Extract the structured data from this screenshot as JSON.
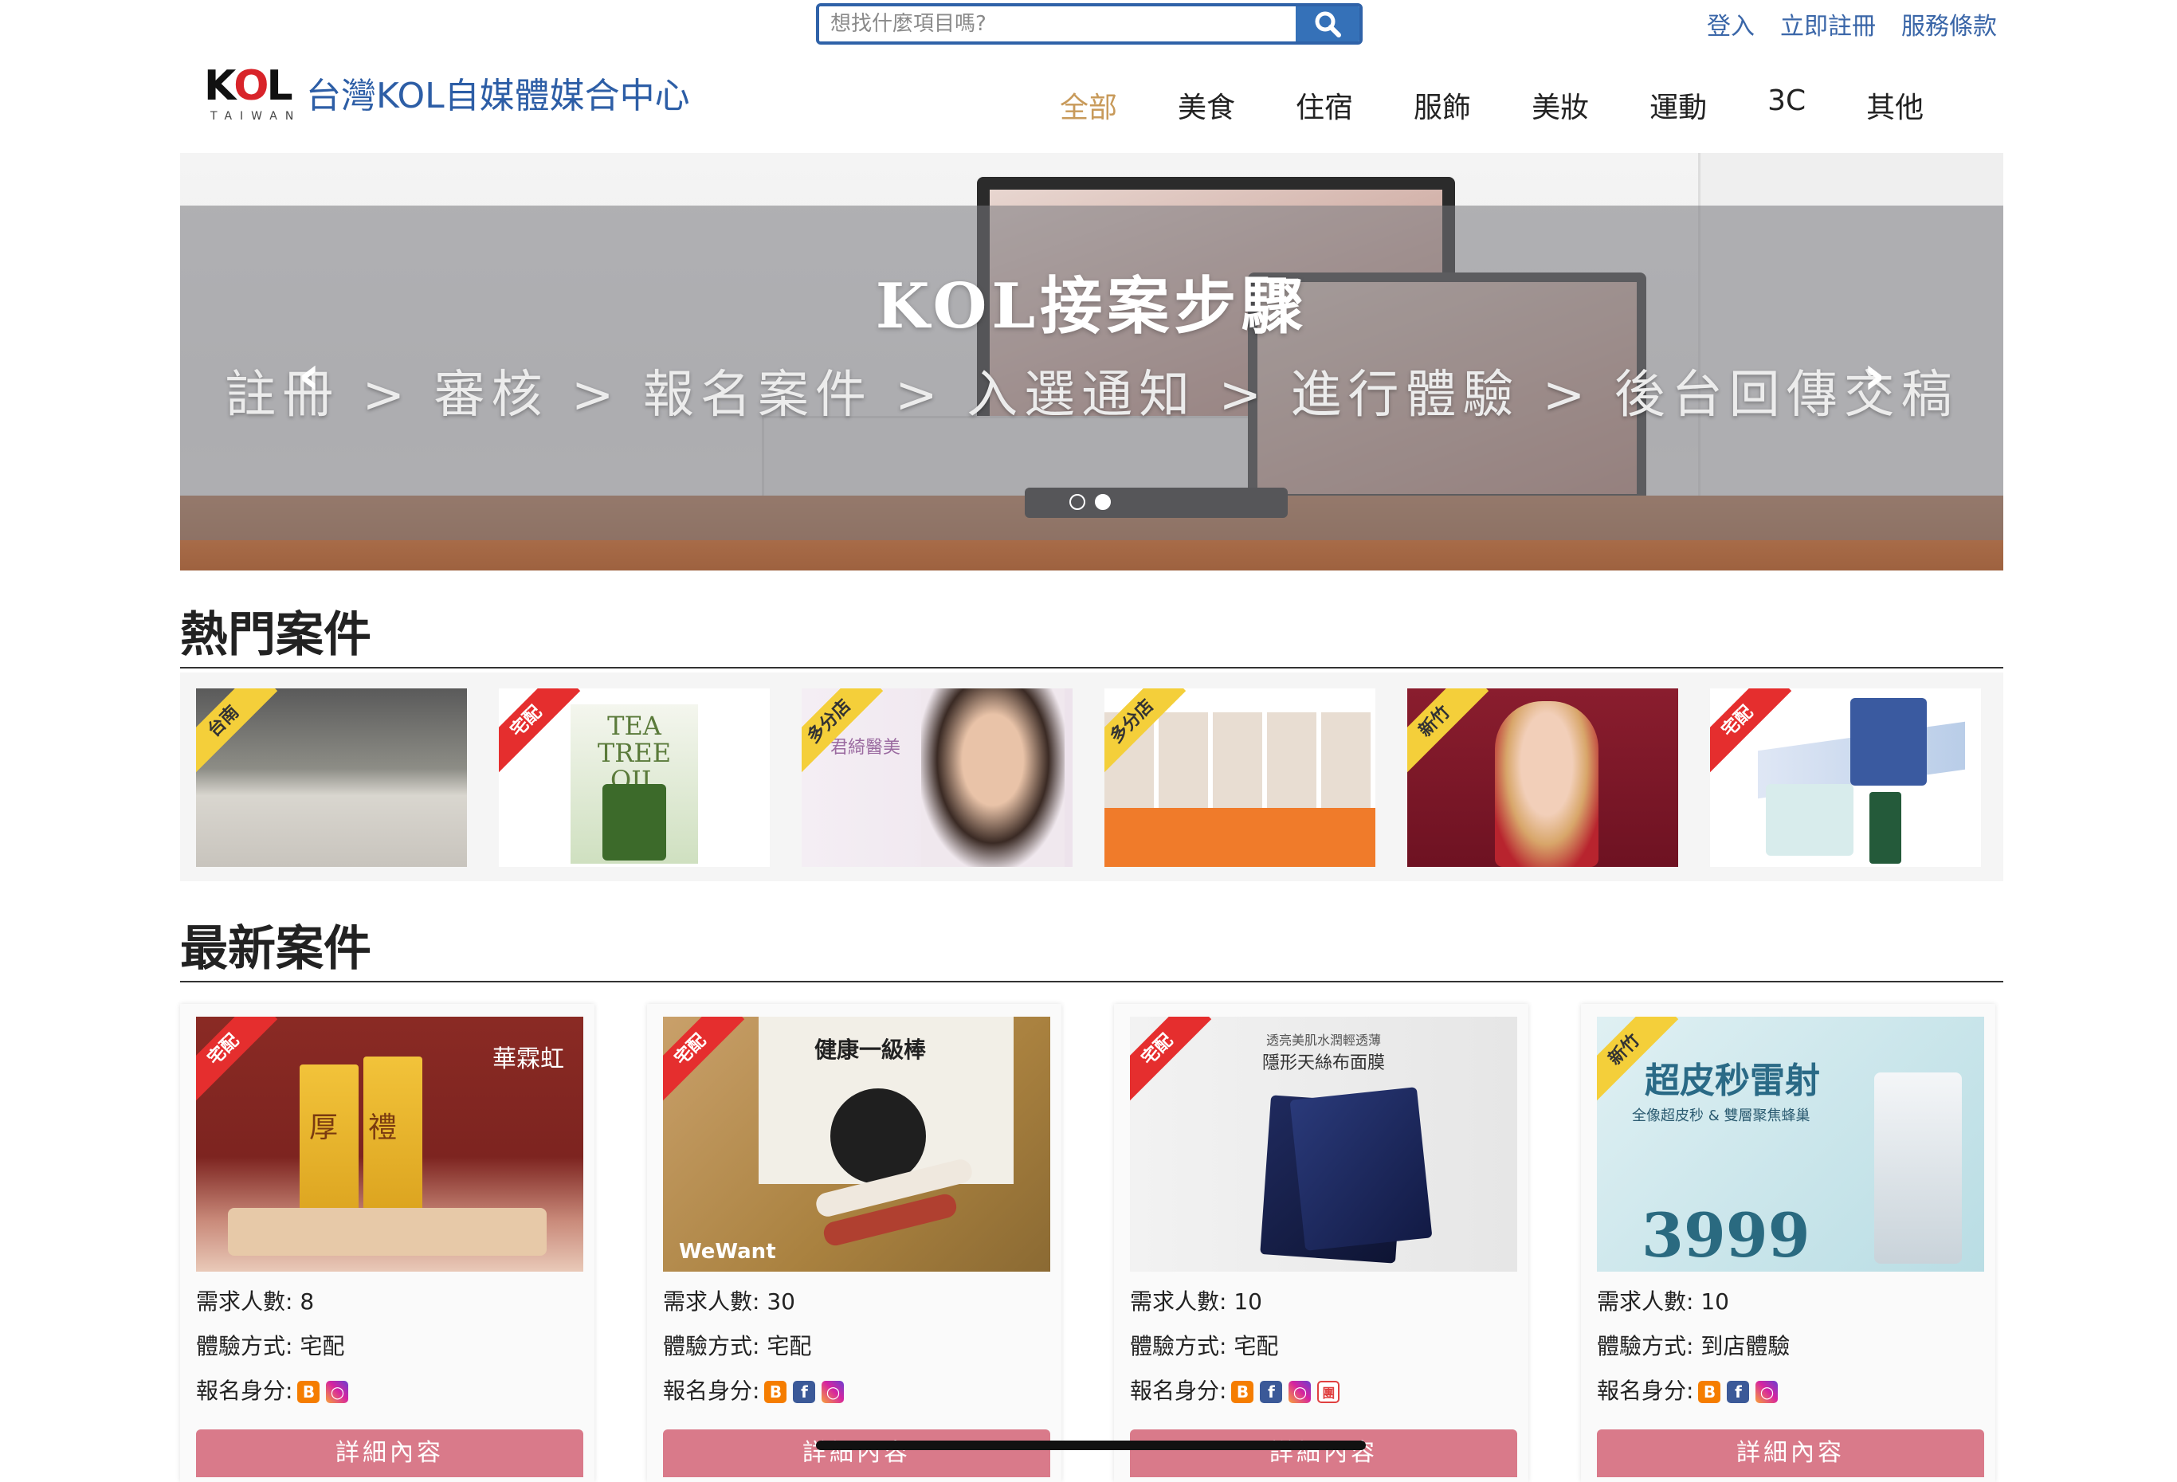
{
  "search": {
    "placeholder": "想找什麼項目嗎?"
  },
  "toplinks": {
    "login": "登入",
    "register": "立即註冊",
    "terms": "服務條款"
  },
  "brand": {
    "mark_k": "K",
    "mark_o": "O",
    "mark_l": "L",
    "mark_sub": "TAIWAN",
    "name": "台灣KOL自媒體媒合中心"
  },
  "nav": [
    "全部",
    "美食",
    "住宿",
    "服飾",
    "美妝",
    "運動",
    "3C",
    "其他"
  ],
  "banner": {
    "title": "KOL接案步驟",
    "steps": "註冊 > 審核 > 報名案件 > 入選通知 > 進行體驗 > 後台回傳交稿",
    "slide_count": 2,
    "active_slide": 2
  },
  "sections": {
    "hot": "熱門案件",
    "latest": "最新案件"
  },
  "hot_cases": [
    {
      "tag": "台南",
      "tag_color": "#f4cf3a"
    },
    {
      "tag": "宅配",
      "tag_color": "#e52e2e",
      "text": "TEA TREE OIL"
    },
    {
      "tag": "多分店",
      "tag_color": "#f4cf3a",
      "text": "君綺醫美"
    },
    {
      "tag": "多分店",
      "tag_color": "#f4cf3a"
    },
    {
      "tag": "新竹",
      "tag_color": "#f4cf3a"
    },
    {
      "tag": "宅配",
      "tag_color": "#e52e2e"
    }
  ],
  "labels": {
    "need": "需求人數: ",
    "method": "體驗方式: ",
    "identity": "報名身分:",
    "detail": "詳細內容"
  },
  "cards": [
    {
      "tag": "宅配",
      "tag_color": "#e52e2e",
      "brand": "華霖虹",
      "product": "厚禮",
      "need": "8",
      "method": "宅配",
      "identities": [
        "blog",
        "instagram"
      ]
    },
    {
      "tag": "宅配",
      "tag_color": "#e52e2e",
      "brand": "WeWant",
      "product": "健康一級棒",
      "need": "30",
      "method": "宅配",
      "identities": [
        "blog",
        "facebook",
        "instagram"
      ]
    },
    {
      "tag": "宅配",
      "tag_color": "#e52e2e",
      "brand": "透亮美肌水潤輕透薄",
      "product": "隱形天絲布面膜",
      "need": "10",
      "method": "宅配",
      "identities": [
        "blog",
        "facebook",
        "instagram",
        "group"
      ]
    },
    {
      "tag": "新竹",
      "tag_color": "#f4cf3a",
      "brand": "全像超皮秒 & 雙層聚焦蜂巢",
      "product": "超皮秒雷射",
      "price": "3999",
      "need": "10",
      "method": "到店體驗",
      "identities": [
        "blog",
        "facebook",
        "instagram"
      ]
    }
  ]
}
